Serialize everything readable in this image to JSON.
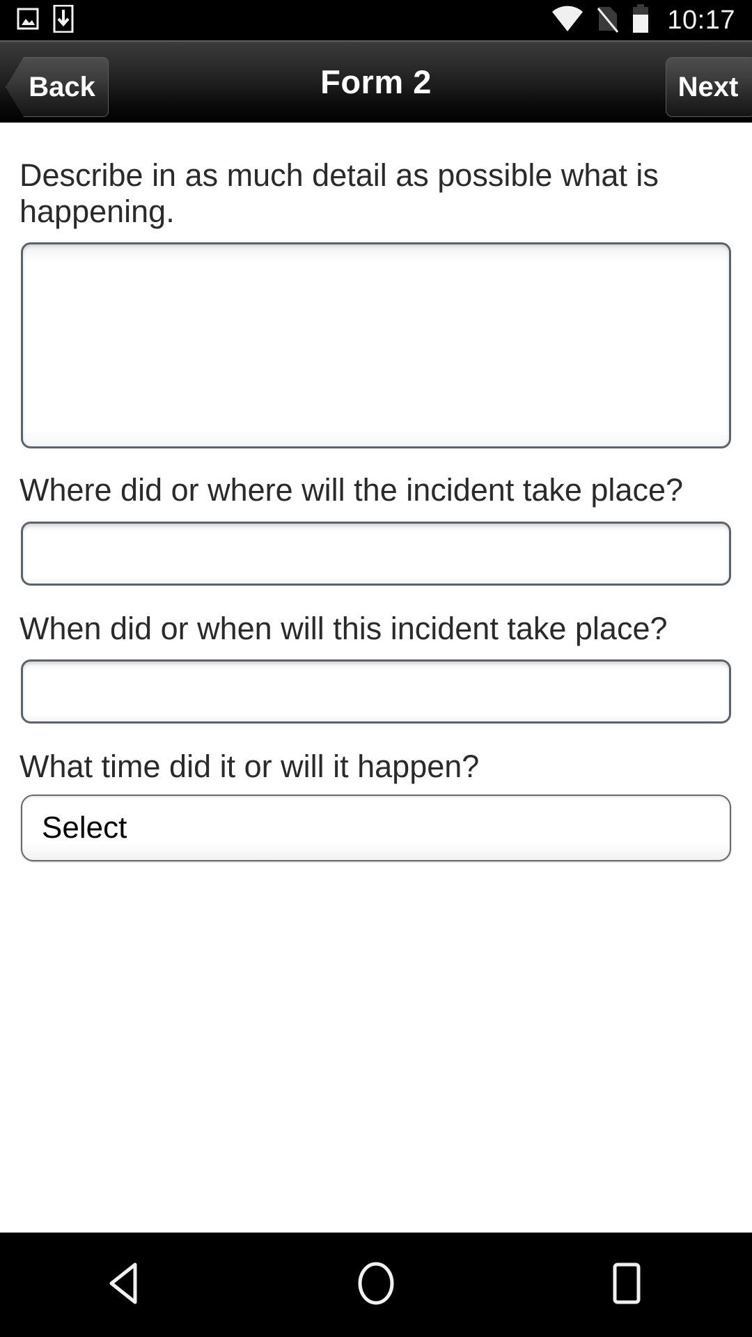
{
  "status_bar": {
    "icons": [
      "image-icon",
      "download-icon",
      "wifi-icon",
      "no-sim-icon",
      "battery-icon"
    ],
    "time": "10:17"
  },
  "titlebar": {
    "back_label": "Back",
    "title": "Form 2",
    "next_label": "Next"
  },
  "form": {
    "questions": [
      {
        "label": "Describe in as much detail as possible what is happening.",
        "type": "textarea",
        "value": "",
        "placeholder": ""
      },
      {
        "label": "Where did or where will the incident take place?",
        "type": "text",
        "value": "",
        "placeholder": ""
      },
      {
        "label": "When did or when will this incident take place?",
        "type": "text",
        "value": "",
        "placeholder": ""
      },
      {
        "label": "What time did it or will it happen?",
        "type": "select",
        "value": "Select"
      }
    ]
  },
  "navbar": {
    "back": "nav-back-icon",
    "home": "nav-home-icon",
    "recents": "nav-recents-icon"
  },
  "colors": {
    "titlebar_top": "#3c3c3c",
    "titlebar_bottom": "#000000",
    "field_border": "#5c626b",
    "text": "#2a2a2a",
    "page_bg": "#ffffff",
    "system_bg": "#000000"
  }
}
